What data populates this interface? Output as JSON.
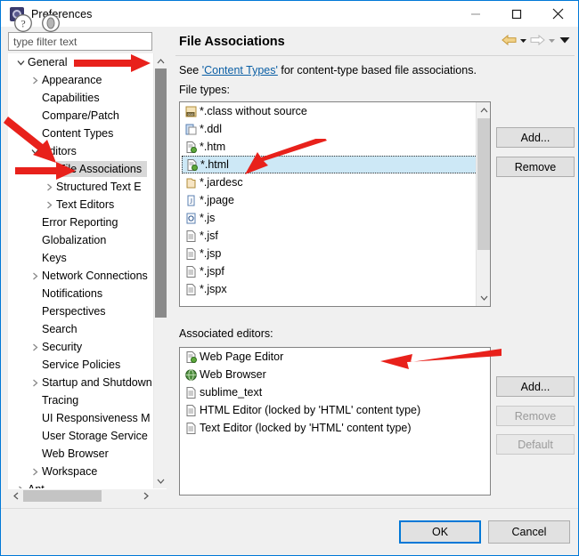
{
  "window": {
    "title": "Preferences",
    "icon": "preferences-icon",
    "controls": {
      "minimize": "minimize-icon",
      "maximize": "maximize-icon",
      "close": "close-icon"
    }
  },
  "sidebar": {
    "filter_placeholder": "type filter text",
    "items": [
      {
        "label": "General",
        "indent": 0,
        "expander": "down",
        "selected": false
      },
      {
        "label": "Appearance",
        "indent": 1,
        "expander": "right",
        "selected": false
      },
      {
        "label": "Capabilities",
        "indent": 1,
        "expander": "none",
        "selected": false
      },
      {
        "label": "Compare/Patch",
        "indent": 1,
        "expander": "none",
        "selected": false
      },
      {
        "label": "Content Types",
        "indent": 1,
        "expander": "none",
        "selected": false
      },
      {
        "label": "Editors",
        "indent": 1,
        "expander": "down",
        "selected": false
      },
      {
        "label": "File Associations",
        "indent": 2,
        "expander": "none",
        "selected": true
      },
      {
        "label": "Structured Text E",
        "indent": 2,
        "expander": "right",
        "selected": false
      },
      {
        "label": "Text Editors",
        "indent": 2,
        "expander": "right",
        "selected": false
      },
      {
        "label": "Error Reporting",
        "indent": 1,
        "expander": "none",
        "selected": false
      },
      {
        "label": "Globalization",
        "indent": 1,
        "expander": "none",
        "selected": false
      },
      {
        "label": "Keys",
        "indent": 1,
        "expander": "none",
        "selected": false
      },
      {
        "label": "Network Connections",
        "indent": 1,
        "expander": "right",
        "selected": false
      },
      {
        "label": "Notifications",
        "indent": 1,
        "expander": "none",
        "selected": false
      },
      {
        "label": "Perspectives",
        "indent": 1,
        "expander": "none",
        "selected": false
      },
      {
        "label": "Search",
        "indent": 1,
        "expander": "none",
        "selected": false
      },
      {
        "label": "Security",
        "indent": 1,
        "expander": "right",
        "selected": false
      },
      {
        "label": "Service Policies",
        "indent": 1,
        "expander": "none",
        "selected": false
      },
      {
        "label": "Startup and Shutdown",
        "indent": 1,
        "expander": "right",
        "selected": false
      },
      {
        "label": "Tracing",
        "indent": 1,
        "expander": "none",
        "selected": false
      },
      {
        "label": "UI Responsiveness M",
        "indent": 1,
        "expander": "none",
        "selected": false
      },
      {
        "label": "User Storage Service",
        "indent": 1,
        "expander": "none",
        "selected": false
      },
      {
        "label": "Web Browser",
        "indent": 1,
        "expander": "none",
        "selected": false
      },
      {
        "label": "Workspace",
        "indent": 1,
        "expander": "right",
        "selected": false
      },
      {
        "label": "Ant",
        "indent": 0,
        "expander": "right",
        "selected": false
      }
    ],
    "scrollbar": {
      "vertical": "tree-vertical-scrollbar",
      "horizontal": "tree-horizontal-scrollbar"
    }
  },
  "page": {
    "title": "File Associations",
    "nav": {
      "back": "back-arrow-icon",
      "back_menu": "back-dropdown-icon",
      "forward": "forward-arrow-icon",
      "forward_menu": "forward-dropdown-icon",
      "menu": "view-menu-icon"
    },
    "description_prefix": "See ",
    "description_link": "'Content Types'",
    "description_suffix": " for content-type based file associations.",
    "file_types_label": "File types:",
    "associated_editors_label": "Associated editors:",
    "file_types": [
      {
        "label": "*.class without source",
        "icon": "class-file-icon",
        "selected": false
      },
      {
        "label": "*.ddl",
        "icon": "ddl-file-icon",
        "selected": false
      },
      {
        "label": "*.htm",
        "icon": "html-file-icon",
        "selected": false
      },
      {
        "label": "*.html",
        "icon": "html-file-icon",
        "selected": true
      },
      {
        "label": "*.jardesc",
        "icon": "jar-file-icon",
        "selected": false
      },
      {
        "label": "*.jpage",
        "icon": "jpage-file-icon",
        "selected": false
      },
      {
        "label": "*.js",
        "icon": "js-file-icon",
        "selected": false
      },
      {
        "label": "*.jsf",
        "icon": "text-file-icon",
        "selected": false
      },
      {
        "label": "*.jsp",
        "icon": "text-file-icon",
        "selected": false
      },
      {
        "label": "*.jspf",
        "icon": "text-file-icon",
        "selected": false
      },
      {
        "label": "*.jspx",
        "icon": "text-file-icon",
        "selected": false
      }
    ],
    "associated_editors": [
      {
        "label": "Web Page Editor",
        "icon": "html-file-icon",
        "selected": false
      },
      {
        "label": "Web Browser",
        "icon": "globe-icon",
        "selected": false
      },
      {
        "label": "sublime_text",
        "icon": "text-file-icon",
        "selected": false
      },
      {
        "label": "HTML Editor (locked by 'HTML' content type)",
        "icon": "text-file-icon",
        "selected": false
      },
      {
        "label": "Text Editor (locked by 'HTML' content type)",
        "icon": "text-file-icon",
        "selected": false
      }
    ],
    "file_type_buttons": [
      {
        "id": "ft-add",
        "label": "Add...",
        "enabled": true
      },
      {
        "id": "ft-remove",
        "label": "Remove",
        "enabled": true
      }
    ],
    "editor_buttons": [
      {
        "id": "ed-add",
        "label": "Add...",
        "enabled": true
      },
      {
        "id": "ed-remove",
        "label": "Remove",
        "enabled": false
      },
      {
        "id": "ed-default",
        "label": "Default",
        "enabled": false
      }
    ]
  },
  "footer": {
    "help_icon": "help-icon",
    "restore_icon": "restore-defaults-icon",
    "ok_label": "OK",
    "cancel_label": "Cancel"
  },
  "colors": {
    "accent": "#0078d7",
    "selection_blue": "#cde8f6",
    "selection_gray": "#d8d8d8",
    "link": "#0b5fa5",
    "annotation_red": "#e8211b",
    "dialog_bg": "#f0f0f0"
  }
}
